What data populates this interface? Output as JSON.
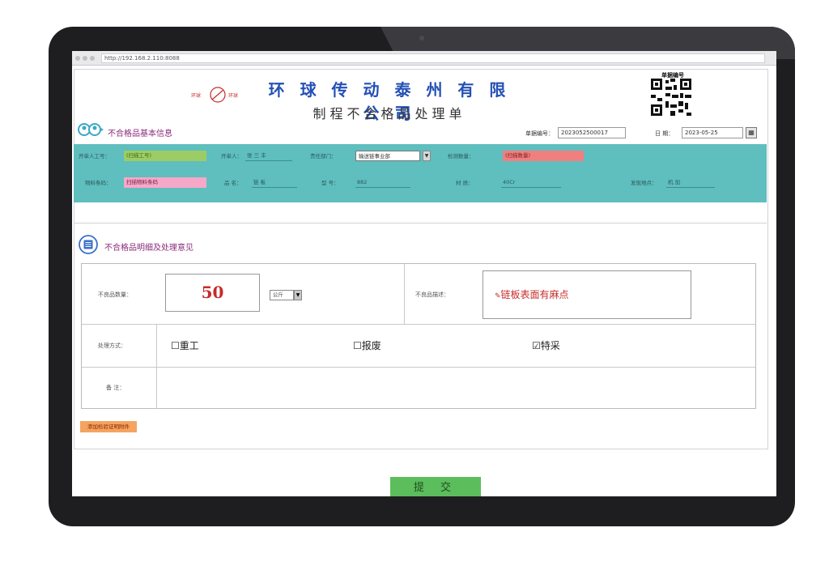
{
  "browser": {
    "url": "http://192.168.2.110:8088"
  },
  "header": {
    "logo_text_left": "环球",
    "logo_text_right": "环球",
    "company": "环 球 传 动 泰 州 有 限 公 司",
    "doc_title": "制程不合格品处理单",
    "qr_label": "单据编号"
  },
  "basic_info": {
    "section_title": "不合格品基本信息",
    "doc_no_label": "单据编号：",
    "doc_no_value": "2023052500017",
    "date_label": "日 期：",
    "date_value": "2023-05-25",
    "date_btn": "▦"
  },
  "teal_form": {
    "row1": [
      {
        "label": "开单人工号：",
        "value": "(扫描工号)"
      },
      {
        "label": "开单人：",
        "value": "张 三 丰"
      },
      {
        "label": "责任部门：",
        "value": "输送链事业部"
      },
      {
        "label": "检测数量：",
        "value": "(扫描数量)"
      }
    ],
    "row2": [
      {
        "label": "物料条码：",
        "value": "扫描物料条码"
      },
      {
        "label": "品 名：",
        "value": "链 板"
      },
      {
        "label": "型 号：",
        "value": "882"
      },
      {
        "label": "材 质：",
        "value": "40Cr"
      },
      {
        "label": "发现地点：",
        "value": "机 加"
      }
    ],
    "select_arrow": "▼"
  },
  "detail": {
    "section_title": "不合格品明细及处理意见",
    "qty_label": "不良品数量：",
    "qty_value": "50",
    "unit_value": "公斤",
    "unit_arrow": "▼",
    "defect_label": "不良品描述：",
    "defect_icon": "✎",
    "defect_value": "链板表面有麻点",
    "method_label": "处理方式：",
    "options": [
      {
        "box": "☐",
        "label": "重工"
      },
      {
        "box": "☐",
        "label": "报废"
      },
      {
        "box": "☑",
        "label": "特采"
      }
    ],
    "remark_label": "备 注：",
    "remark_value": ""
  },
  "actions": {
    "attach_label": "添加检验证明附件",
    "submit_label": "提 交"
  },
  "colors": {
    "brand_blue": "#2350b5",
    "teal": "#5fbebe",
    "submit_green": "#5cbd5c",
    "defect_red": "#c82a2a"
  }
}
